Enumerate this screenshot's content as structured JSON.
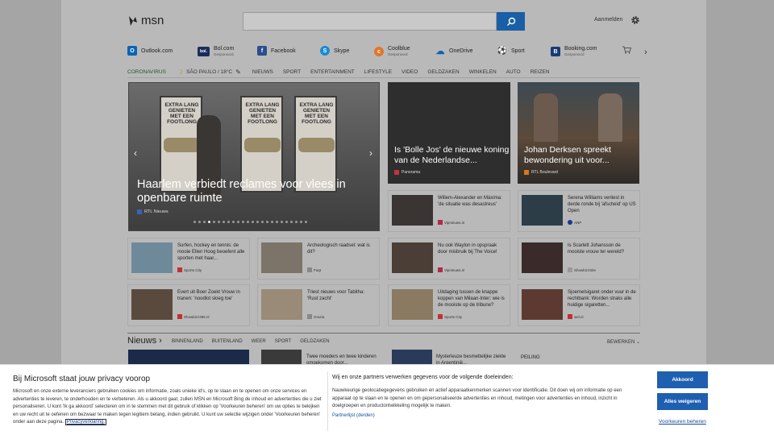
{
  "header": {
    "logo_text": "msn",
    "search_placeholder": "",
    "signin": "Aanmelden"
  },
  "quicklinks": [
    {
      "label": "Outlook.com",
      "sub": "",
      "color": "#0a64b4",
      "glyph": "O"
    },
    {
      "label": "Bol.com",
      "sub": "Gesponsord",
      "color": "#1b2d5b",
      "glyph": "bol."
    },
    {
      "label": "Facebook",
      "sub": "",
      "color": "#2b4e8f",
      "glyph": "f"
    },
    {
      "label": "Skype",
      "sub": "",
      "color": "#1a8ad4",
      "glyph": "S"
    },
    {
      "label": "Coolblue",
      "sub": "Gesponsord",
      "color": "#e2762a",
      "glyph": "c"
    },
    {
      "label": "OneDrive",
      "sub": "",
      "color": "#0a64b4",
      "glyph": "☁"
    },
    {
      "label": "Sport",
      "sub": "",
      "color": "#555555",
      "glyph": "⚽"
    },
    {
      "label": "Booking.com",
      "sub": "Gesponsord",
      "color": "#173b75",
      "glyph": "B"
    }
  ],
  "nav": {
    "corona": "CORONAVIRUS",
    "weather": "SÃO PAULO / 18°C",
    "items": [
      "NIEUWS",
      "SPORT",
      "ENTERTAINMENT",
      "LIFESTYLE",
      "VIDEO",
      "GELDZAKEN",
      "WINKELEN",
      "AUTO",
      "REIZEN"
    ]
  },
  "hero": {
    "title": "Haarlem verbiedt reclames voor vlees in openbare ruimte",
    "source": "RTL Nieuws",
    "poster_text": "EXTRA LANG GENIETEN MET EEN FOOTLONG"
  },
  "big_tiles": [
    {
      "title": "Is 'Bolle Jos' de nieuwe koning van de Nederlandse...",
      "source": "Panorama"
    },
    {
      "title": "Johan Derksen spreekt bewondering uit voor...",
      "source": "RTL Boulevard"
    }
  ],
  "cards": [
    {
      "text": "Willem-Alexander en Máxima: 'de situatie was desastreus'",
      "source": "Vipnieuws.nl"
    },
    {
      "text": "Serena Williams verliest in derde ronde bij 'afscheid' op US Open",
      "source": "ANP"
    },
    {
      "text": "Surfen, hockey en tennis: de mooie Ellen Hoog beoefent alle sporten met haar...",
      "source": "Sports City"
    },
    {
      "text": "Archeologisch raadsel: wat is dit?",
      "source": "Faqt"
    },
    {
      "text": "Nu ook Waylon in opspraak door misbruik bij The Voice!",
      "source": "Vipnieuws.nl"
    },
    {
      "text": "Is Scarlett Johansson de mooiste vrouw ter wereld?",
      "source": "ShowbizzSite"
    },
    {
      "text": "Evert uit Boer Zoekt Vrouw in tranen: 'noodlot sloeg toe'",
      "source": "Showbizz365.nl"
    },
    {
      "text": "Triest nieuws voor Tabitha: 'Rust zacht'",
      "source": "Grazia"
    },
    {
      "text": "Uitdaging tussen de knappe koppen van Milaan-Inter: wie is de mooiste op de tribune?",
      "source": "Sports City"
    },
    {
      "text": "Sjoemelsigaret onder vuur in de rechtbank: Worden straks alle huidige sigaretten...",
      "source": "wel.nl"
    }
  ],
  "news": {
    "heading": "Nieuws",
    "tabs": [
      "BINNENLAND",
      "BUITENLAND",
      "WEER",
      "SPORT",
      "GELDZAKEN"
    ],
    "edit": "BEWERKEN",
    "items": [
      "Twee moeders en twee kinderen omgekomen door...",
      "Mysterieuze besmettelijke ziekte in Argentinië...",
      "PEILING"
    ]
  },
  "banner": {
    "title": "Bij Microsoft staat jouw privacy voorop",
    "body1": "Microsoft en onze externe leveranciers gebruiken cookies om informatie, zoals unieke id's, op te slaan en te openen om onze services en advertenties te leveren, te onderhouden en te verbeteren. Als u akkoord gaat, zullen MSN en Microsoft Bing de inhoud en advertenties die u ziet personaliseren. U kunt 'Ik ga akkoord' selecteren om in te stemmen met dit gebruik of klikken op 'Voorkeuren beheren' om uw opties te bekijken en uw recht uit te oefenen om bezwaar te maken tegen legitiem belang, indien gebruikt. U kunt uw selectie wijzigen onder 'Voorkeuren beheren' onder aan deze pagina.",
    "privacy_link": "Privacyverklaring.",
    "title2": "Wij en onze partners verwerken gegevens voor de volgende doeleinden:",
    "body2": "Nauwkeurige geolocatiegegevens gebruiken en actief apparaatkenmerken scannen voor identificatie. Dit doen wij om informatie op een apparaat op te slaan en te openen en om gepersonaliseerde advertenties en inhoud, metingen voor advertenties en inhoud, inzicht in doelgroepen en productontwikkeling mogelijk te maken.",
    "partners": "Partnerlijst (derden)",
    "accept": "Akkoord",
    "reject": "Alles weigeren",
    "prefs": "Voorkeuren beheren"
  }
}
